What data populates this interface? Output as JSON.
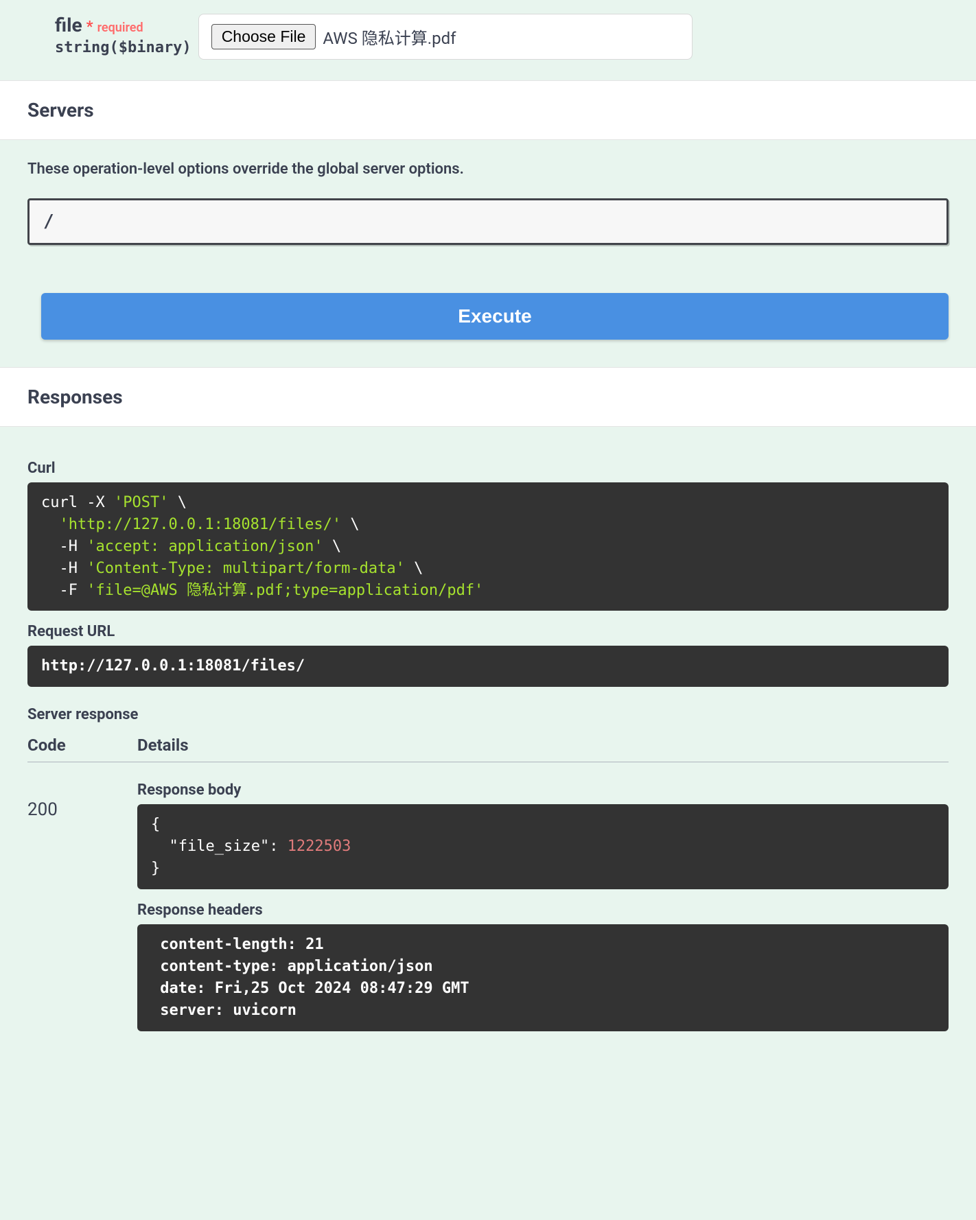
{
  "param": {
    "name": "file",
    "required_star": "*",
    "required_text": "required",
    "type": "string($binary)",
    "choose_button": "Choose File",
    "file_name": "AWS 隐私计算.pdf"
  },
  "servers": {
    "heading": "Servers",
    "note": "These operation-level options override the global server options.",
    "value": "/"
  },
  "execute": {
    "label": "Execute"
  },
  "responses": {
    "heading": "Responses",
    "curl_label": "Curl",
    "curl": {
      "l1_a": "curl -X ",
      "l1_b": "'POST'",
      "l1_c": " \\",
      "l2_a": "  ",
      "l2_b": "'http://127.0.0.1:18081/files/'",
      "l2_c": " \\",
      "l3_a": "  -H ",
      "l3_b": "'accept: application/json'",
      "l3_c": " \\",
      "l4_a": "  -H ",
      "l4_b": "'Content-Type: multipart/form-data'",
      "l4_c": " \\",
      "l5_a": "  -F ",
      "l5_b": "'file=@AWS 隐私计算.pdf;type=application/pdf'"
    },
    "request_url_label": "Request URL",
    "request_url": "http://127.0.0.1:18081/files/",
    "server_response_label": "Server response",
    "code_col": "Code",
    "details_col": "Details",
    "code_value": "200",
    "response_body_label": "Response body",
    "response_body": {
      "open": "{",
      "key": "  \"file_size\"",
      "colon": ": ",
      "value": "1222503",
      "close": "}"
    },
    "response_headers_label": "Response headers",
    "response_headers": " content-length: 21 \n content-type: application/json \n date: Fri,25 Oct 2024 08:47:29 GMT \n server: uvicorn "
  }
}
